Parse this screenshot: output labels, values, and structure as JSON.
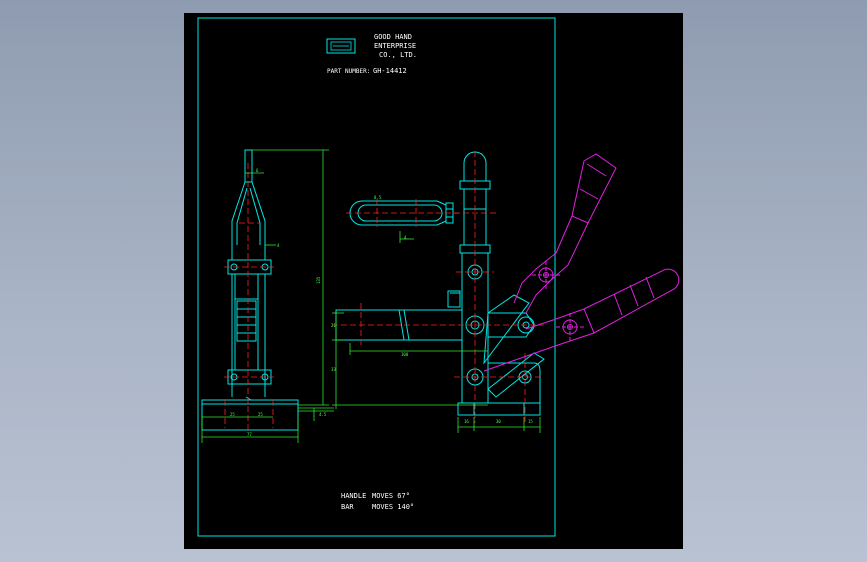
{
  "title_block": {
    "company_line1": "GOOD HAND",
    "company_line2": "ENTERPRISE",
    "company_line3": "CO., LTD.",
    "part_number_label": "PART NUMBER:",
    "part_number": "GH-14412"
  },
  "notes": {
    "line1_label": "HANDLE",
    "line1_text": "MOVES 67°",
    "line2_label": "BAR",
    "line2_text": "MOVES 140°"
  },
  "dimensions": {
    "side_top_width": "6",
    "side_arm_gap": "4",
    "side_base_left": "25",
    "side_base_right": "25",
    "side_base_total": "77",
    "side_overall_height": "135",
    "side_foot_height": "4.5",
    "bar_diameter": "8.5",
    "bar_offset": "4",
    "body_height_left": "21",
    "body_height_lower": "33",
    "arm_length": "100",
    "base_width_a": "16",
    "base_width_b": "30",
    "base_width_c": "15"
  },
  "colors": {
    "sheet": "#000000",
    "border": "#00e5e5",
    "outline": "#00e5e5",
    "centerline": "#ff2020",
    "dimension": "#2ee82e",
    "alternate_position": "#e020e0",
    "text": "#ffffff"
  }
}
